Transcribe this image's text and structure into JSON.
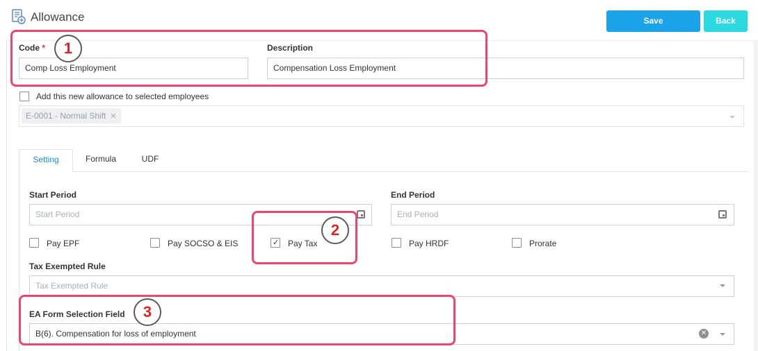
{
  "header": {
    "title": "Allowance",
    "save_label": "Save",
    "back_label": "Back"
  },
  "form": {
    "code_label": "Code",
    "code_required_mark": "*",
    "code_value": "Comp Loss Employment",
    "description_label": "Description",
    "description_value": "Compensation Loss Employment",
    "add_to_employees_label": "Add this new allowance to selected employees",
    "add_to_employees_checked": false,
    "selected_tag": "E-0001 - Normal Shift"
  },
  "tabs": [
    {
      "label": "Setting",
      "active": true
    },
    {
      "label": "Formula",
      "active": false
    },
    {
      "label": "UDF",
      "active": false
    }
  ],
  "setting": {
    "start_period_label": "Start Period",
    "start_period_placeholder": "Start Period",
    "end_period_label": "End Period",
    "end_period_placeholder": "End Period",
    "checkboxes": [
      {
        "label": "Pay EPF",
        "checked": false
      },
      {
        "label": "Pay SOCSO & EIS",
        "checked": false
      },
      {
        "label": "Pay Tax",
        "checked": true
      },
      {
        "label": "Pay HRDF",
        "checked": false
      },
      {
        "label": "Prorate",
        "checked": false
      }
    ],
    "tax_exempted_label": "Tax Exempted Rule",
    "tax_exempted_placeholder": "Tax Exempted Rule",
    "ea_form_label": "EA Form Selection Field",
    "ea_form_value": "B(6). Compensation for loss of employment"
  },
  "annotations": {
    "callouts": [
      "1",
      "2",
      "3"
    ],
    "color": "#f0436e"
  },
  "colors": {
    "save": "#1aa3e8",
    "back": "#2bd9e0",
    "active_tab": "#1a8fd6"
  }
}
